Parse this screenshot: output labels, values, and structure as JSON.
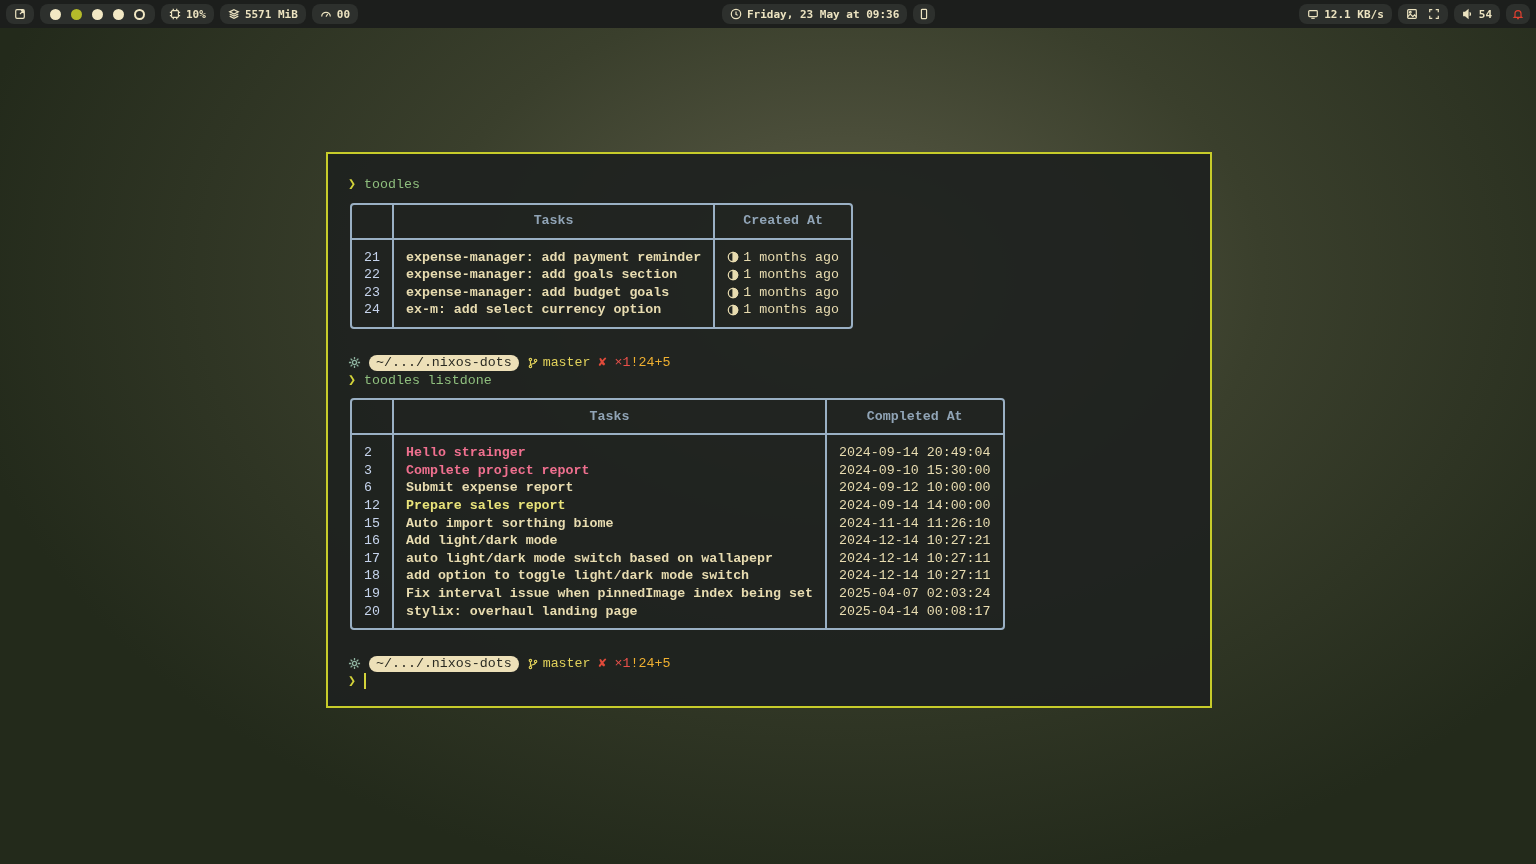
{
  "top_bar": {
    "workspaces": [
      {
        "occupied": true,
        "selected": false
      },
      {
        "occupied": true,
        "selected": true
      },
      {
        "occupied": true,
        "selected": false
      },
      {
        "occupied": true,
        "selected": false
      },
      {
        "occupied": false,
        "selected": false
      }
    ],
    "cpu": "10%",
    "memory": "5571 MiB",
    "gpu": "00",
    "clock": "Friday, 23 May at 09:36",
    "network": "12.1 KB/s",
    "volume": "54"
  },
  "terminal": {
    "blocks": [
      {
        "kind": "command",
        "symbol": "❯",
        "command": "toodles"
      },
      {
        "kind": "table",
        "columns": [
          "",
          "Tasks",
          "Created At"
        ],
        "rows": [
          {
            "id": "21",
            "task": "expense-manager: add payment reminder",
            "when": "1 months ago",
            "color": "#e8dcb0"
          },
          {
            "id": "22",
            "task": "expense-manager: add goals section",
            "when": "1 months ago",
            "color": "#e8dcb0"
          },
          {
            "id": "23",
            "task": "expense-manager: add budget goals",
            "when": "1 months ago",
            "color": "#e8dcb0"
          },
          {
            "id": "24",
            "task": "ex-m: add select currency option",
            "when": "1 months ago",
            "color": "#e8dcb0"
          }
        ]
      },
      {
        "kind": "prompt",
        "path": "~/.../.nixos-dots",
        "branch": "master",
        "status_mark": "✘",
        "conflicts": "×1",
        "changes": "!24+5"
      },
      {
        "kind": "command",
        "symbol": "❯",
        "command": "toodles listdone"
      },
      {
        "kind": "table",
        "columns": [
          "",
          "Tasks",
          "Completed At"
        ],
        "rows": [
          {
            "id": "2",
            "task": "Hello strainger",
            "when": "2024-09-14 20:49:04",
            "color": "#f0708f"
          },
          {
            "id": "3",
            "task": "Complete project report",
            "when": "2024-09-10 15:30:00",
            "color": "#f0708f"
          },
          {
            "id": "6",
            "task": "Submit expense report",
            "when": "2024-09-12 10:00:00",
            "color": "#e8dcb0"
          },
          {
            "id": "12",
            "task": "Prepare sales report",
            "when": "2024-09-14 14:00:00",
            "color": "#eae47a"
          },
          {
            "id": "15",
            "task": "Auto import sorthing biome",
            "when": "2024-11-14 11:26:10",
            "color": "#e8dcb0"
          },
          {
            "id": "16",
            "task": "Add light/dark mode",
            "when": "2024-12-14 10:27:21",
            "color": "#e8dcb0"
          },
          {
            "id": "17",
            "task": "auto light/dark mode switch based on wallapepr",
            "when": "2024-12-14 10:27:11",
            "color": "#e8dcb0"
          },
          {
            "id": "18",
            "task": "add option to toggle light/dark mode switch",
            "when": "2024-12-14 10:27:11",
            "color": "#e8dcb0"
          },
          {
            "id": "19",
            "task": "Fix interval issue when pinnedImage index being set",
            "when": "2025-04-07 02:03:24",
            "color": "#e8dcb0"
          },
          {
            "id": "20",
            "task": "stylix: overhaul landing page",
            "when": "2025-04-14 00:08:17",
            "color": "#e8dcb0"
          }
        ]
      },
      {
        "kind": "prompt",
        "path": "~/.../.nixos-dots",
        "branch": "master",
        "status_mark": "✘",
        "conflicts": "×1",
        "changes": "!24+5"
      },
      {
        "kind": "input",
        "symbol": "❯"
      }
    ]
  }
}
